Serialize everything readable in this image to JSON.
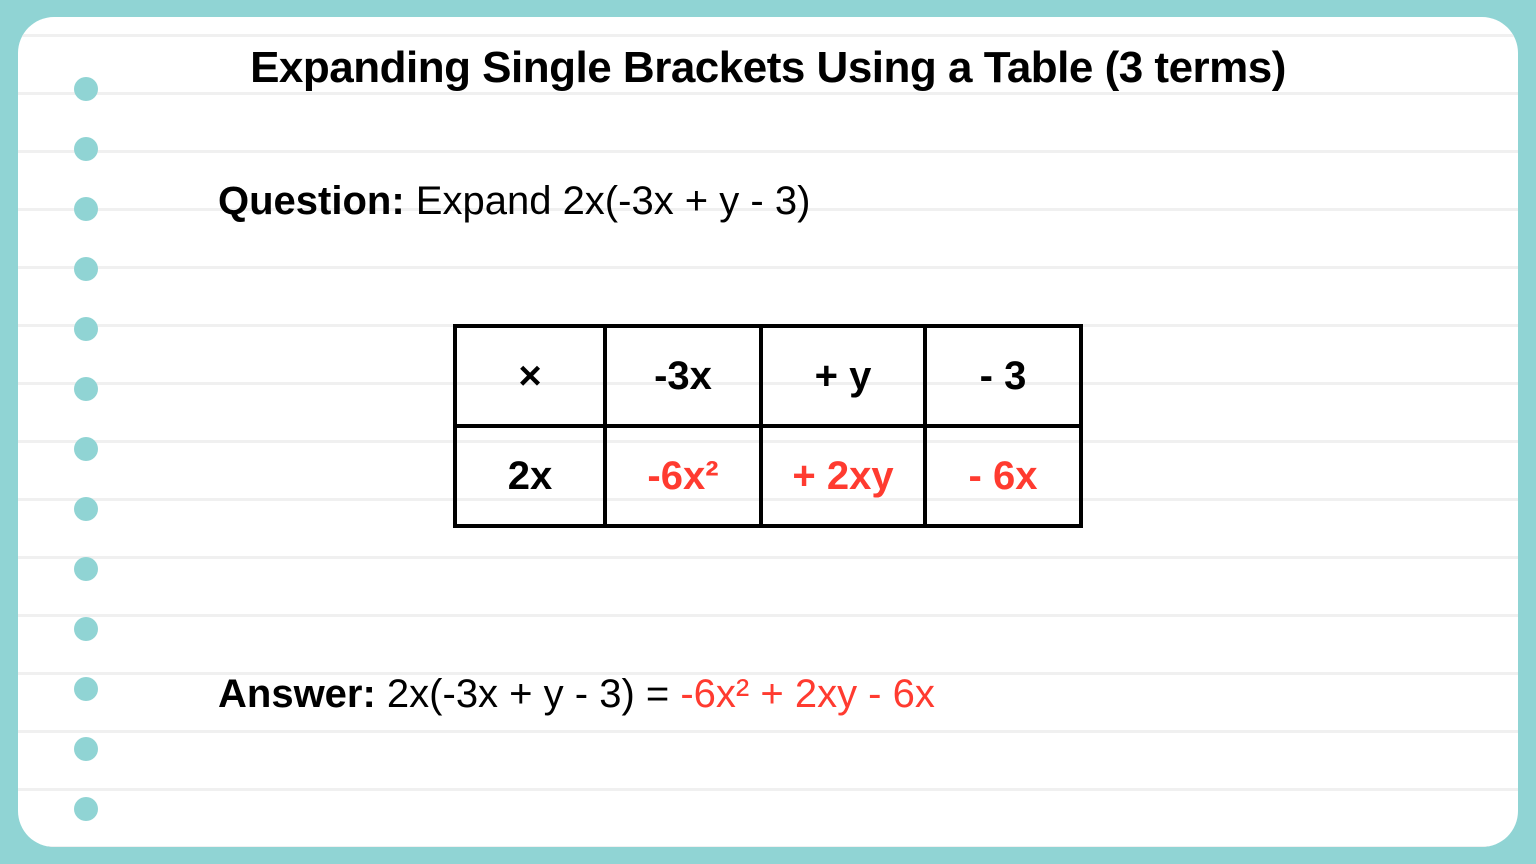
{
  "title": "Expanding Single Brackets Using a Table (3 terms)",
  "question": {
    "label": "Question:",
    "text": " Expand 2x(-3x + y - 3)"
  },
  "grid": {
    "r0": {
      "c0": "×",
      "c1": "-3x",
      "c2": "+ y",
      "c3": "- 3"
    },
    "r1": {
      "c0": "2x",
      "c1": "-6x²",
      "c2": "+ 2xy",
      "c3": "- 6x"
    }
  },
  "answer": {
    "label": "Answer:",
    "text": " 2x(-3x + y - 3) = ",
    "result": "-6x² + 2xy - 6x"
  }
}
